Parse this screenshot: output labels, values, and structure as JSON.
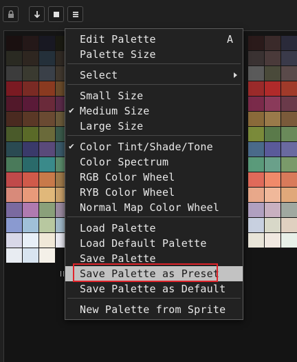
{
  "toolbar": {
    "buttons": [
      {
        "icon": "lock-icon"
      },
      {
        "icon": "arrow-down-icon"
      },
      {
        "icon": "square-icon"
      },
      {
        "icon": "menu-icon"
      }
    ]
  },
  "palette": {
    "left_rows": [
      [
        "#1a1010",
        "#241818",
        "#181822",
        "#1a1a12"
      ],
      [
        "#2a2a22",
        "#2e2620",
        "#24303a",
        "#302a24"
      ],
      [
        "#3c3c3c",
        "#3a3a30",
        "#3a4048",
        "#40382e"
      ],
      [
        "#7a1a22",
        "#7a2a24",
        "#8a3a20",
        "#6a4a2a"
      ],
      [
        "#52182a",
        "#5a1a38",
        "#6a2a3a",
        "#5a2a48"
      ],
      [
        "#4a2a20",
        "#5a3826",
        "#6a4a32",
        "#6a5a3a"
      ],
      [
        "#4a5a2a",
        "#5a6a28",
        "#6a6a3a",
        "#3a5a4a"
      ],
      [
        "#2a4a52",
        "#3a3a6a",
        "#5a4a7a",
        "#3a5a6a"
      ],
      [
        "#4a7a5a",
        "#2a6a6a",
        "#3a8a8a",
        "#5a8a6a"
      ],
      [
        "#c04a4a",
        "#d05a4a",
        "#c87a4a",
        "#a07a4a"
      ],
      [
        "#d88a7a",
        "#e89a7a",
        "#e0b87a",
        "#c8a06a"
      ],
      [
        "#7a6aa0",
        "#b07ab0",
        "#8aa07a",
        "#9a8aa0"
      ],
      [
        "#8a9ad0",
        "#a0c0d8",
        "#b8c8a0",
        "#a0b8c8"
      ],
      [
        "#d8d8e8",
        "#e8f0f8",
        "#f0e8d8",
        "#e8e8f0"
      ],
      [
        "#e8ecf2",
        "#d8e4f0",
        "#f4f0e8"
      ]
    ],
    "right_rows": [
      [
        "#2a1a1a",
        "#3a2a2a",
        "#2a2a3a"
      ],
      [
        "#3a3232",
        "#4a3a3a",
        "#3a3a4a"
      ],
      [
        "#5a5a5a",
        "#4a4a3a",
        "#5a4a4a"
      ],
      [
        "#9a2a2a",
        "#b02a2a",
        "#a03a2a"
      ],
      [
        "#7a2a4a",
        "#8a3a5a",
        "#6a3a4a"
      ],
      [
        "#8a6a3a",
        "#9a7a4a",
        "#7a5a3a"
      ],
      [
        "#7a8a3a",
        "#5a7a4a",
        "#6a8a5a"
      ],
      [
        "#4a6a8a",
        "#5a5a9a",
        "#6a6aa0"
      ],
      [
        "#5a9a7a",
        "#6aa08a",
        "#7a9a6a"
      ],
      [
        "#e06a5a",
        "#f08a6a",
        "#d87a5a"
      ],
      [
        "#e8a88a",
        "#f0b89a",
        "#e0a87a"
      ],
      [
        "#b0a0c0",
        "#c8b0c0",
        "#a0a8a0"
      ],
      [
        "#c8d0e0",
        "#d8d8c8",
        "#e0d0c0"
      ],
      [
        "#e8e4d8",
        "#f0e8e0",
        "#e8f0e8"
      ]
    ]
  },
  "menu": {
    "items": [
      {
        "label": "Edit Palette",
        "shortcut": "A"
      },
      {
        "label": "Palette Size"
      },
      {
        "label": "Select",
        "submenu": true
      },
      {
        "label": "Small Size"
      },
      {
        "label": "Medium Size",
        "checked": true
      },
      {
        "label": "Large Size"
      },
      {
        "label": "Color Tint/Shade/Tone",
        "checked": true
      },
      {
        "label": "Color Spectrum"
      },
      {
        "label": "RGB Color Wheel"
      },
      {
        "label": "RYB Color Wheel"
      },
      {
        "label": "Normal Map Color Wheel"
      },
      {
        "label": "Load Palette"
      },
      {
        "label": "Load Default Palette"
      },
      {
        "label": "Save Palette"
      },
      {
        "label": "Save Palette as Preset",
        "highlighted": true
      },
      {
        "label": "Save Palette as Default"
      },
      {
        "label": "New Palette from Sprite"
      }
    ],
    "check_glyph": "✔"
  },
  "annotation": {
    "color": "#e0242b"
  }
}
